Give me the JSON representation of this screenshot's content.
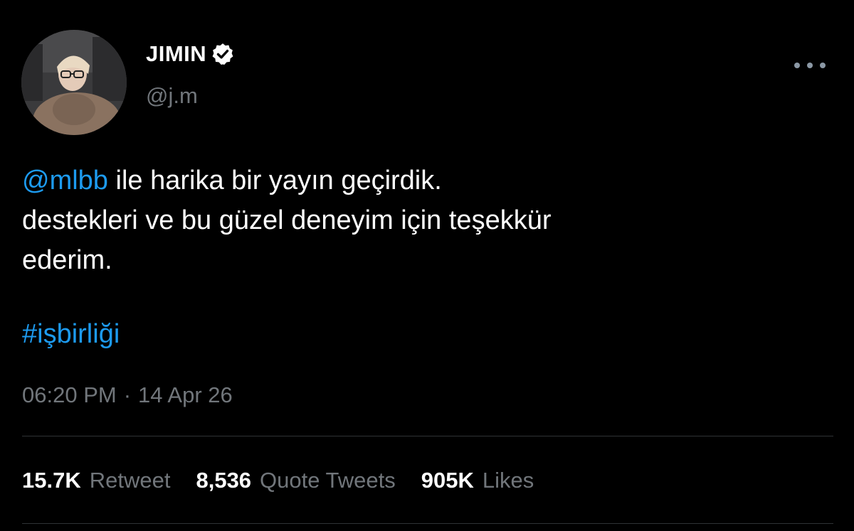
{
  "user": {
    "display_name": "JIMIN",
    "handle": "@j.m",
    "verified": true,
    "avatar": "profile-photo"
  },
  "tweet": {
    "mention": "@mlbb",
    "line1_rest": " ile harika bir yayın geçirdik.",
    "line2": "destekleri ve bu güzel deneyim için teşekkür",
    "line3": "ederim.",
    "hashtag": "#işbirliği",
    "time": "06:20 PM",
    "separator": "·",
    "date": "14 Apr 26"
  },
  "stats": [
    {
      "count": "15.7K",
      "label": "Retweet"
    },
    {
      "count": "8,536",
      "label": "Quote Tweets"
    },
    {
      "count": "905K",
      "label": "Likes"
    }
  ],
  "colors": {
    "background": "#000000",
    "link": "#1d9bf0",
    "secondary_text": "#71767b",
    "divider": "#2f3336"
  },
  "icons": {
    "verified": "verified-badge-icon",
    "more": "more-options-icon"
  }
}
